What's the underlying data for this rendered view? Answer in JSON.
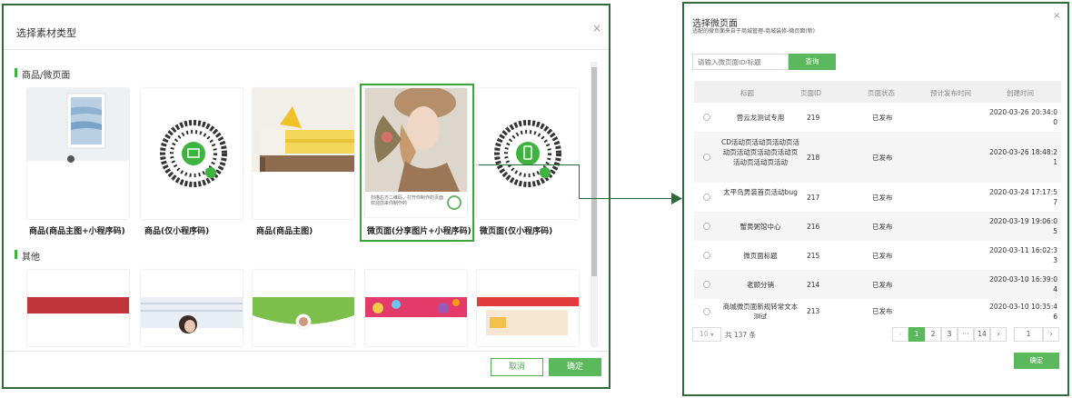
{
  "left_dialog": {
    "title": "选择素材类型",
    "close": "×",
    "section1": "商品/微页面",
    "section2": "其他",
    "cards": [
      {
        "label": "商品(商品主图+小程序码)",
        "icon": "product-image-icon"
      },
      {
        "label": "商品(仅小程序码)",
        "icon": "qrcode-icon"
      },
      {
        "label": "商品(商品主图)",
        "icon": "product-image-icon"
      },
      {
        "label": "微页面(分享图片+小程序码)",
        "icon": "portrait-image-icon",
        "caption": "扫描右方二维码，打开你制作的页面 欢迎前来你制作的"
      },
      {
        "label": "微页面(仅小程序码)",
        "icon": "qrcode-icon"
      }
    ],
    "cancel": "取消",
    "confirm": "确定"
  },
  "right_dialog": {
    "title": "选择微页面",
    "subtitle": "适配的微页面来自于商城管理-商城装修-微页面(新)",
    "close": "×",
    "search_placeholder": "请输入微页面ID/标题",
    "search_button": "查询",
    "columns": [
      "标题",
      "页面ID",
      "页面状态",
      "预计发布时间",
      "创建时间"
    ],
    "rows": [
      {
        "title": "营云龙测试专用",
        "id": "219",
        "status": "已发布",
        "scheduled": "",
        "created": "2020-03-26 20:34:00"
      },
      {
        "title": "CD活动页活动页活动页活动页活动页活动页活动页活动页活动页活动",
        "id": "218",
        "status": "已发布",
        "scheduled": "",
        "created": "2020-03-26 18:48:21"
      },
      {
        "title": "太平鸟男装首页活动bug",
        "id": "217",
        "status": "已发布",
        "scheduled": "",
        "created": "2020-03-24 17:17:57"
      },
      {
        "title": "蟹黄粥馆中心",
        "id": "216",
        "status": "已发布",
        "scheduled": "",
        "created": "2020-03-19 19:06:05"
      },
      {
        "title": "微页面标题",
        "id": "215",
        "status": "已发布",
        "scheduled": "",
        "created": "2020-03-11 16:02:33"
      },
      {
        "title": "老顾分销",
        "id": "214",
        "status": "已发布",
        "scheduled": "",
        "created": "2020-03-10 16:39:04"
      },
      {
        "title": "商城微页面新规转常文本测试",
        "id": "213",
        "status": "已发布",
        "scheduled": "",
        "created": "2020-03-10 10:35:46"
      }
    ],
    "page_size": "10",
    "total": "共 137 条",
    "pages": [
      "1",
      "2",
      "3",
      "···",
      "14"
    ],
    "prev": "‹",
    "next": "›",
    "jump_value": "1",
    "confirm": "确定"
  },
  "colors": {
    "accent": "#5cb85c",
    "border": "#2f6b3a"
  }
}
